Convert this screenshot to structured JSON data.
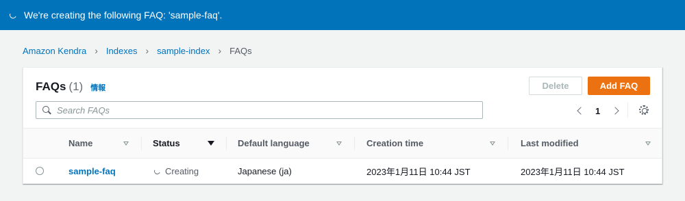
{
  "flash": {
    "message": "We're creating the following FAQ: 'sample-faq'."
  },
  "breadcrumb": [
    "Amazon Kendra",
    "Indexes",
    "sample-index"
  ],
  "breadcrumb_current": "FAQs",
  "panel": {
    "title": "FAQs",
    "count": "(1)",
    "info_label": "情報",
    "delete_label": "Delete",
    "add_label": "Add FAQ",
    "search_placeholder": "Search FAQs",
    "page": "1"
  },
  "table": {
    "columns": [
      "Name",
      "Status",
      "Default language",
      "Creation time",
      "Last modified"
    ],
    "rows": [
      {
        "name": "sample-faq",
        "status": "Creating",
        "language": "Japanese (ja)",
        "created": "2023年1月11日 10:44 JST",
        "modified": "2023年1月11日 10:44 JST"
      }
    ]
  },
  "colors": {
    "flash": "#0073bb",
    "primary": "#ec7211",
    "link": "#0073bb"
  }
}
